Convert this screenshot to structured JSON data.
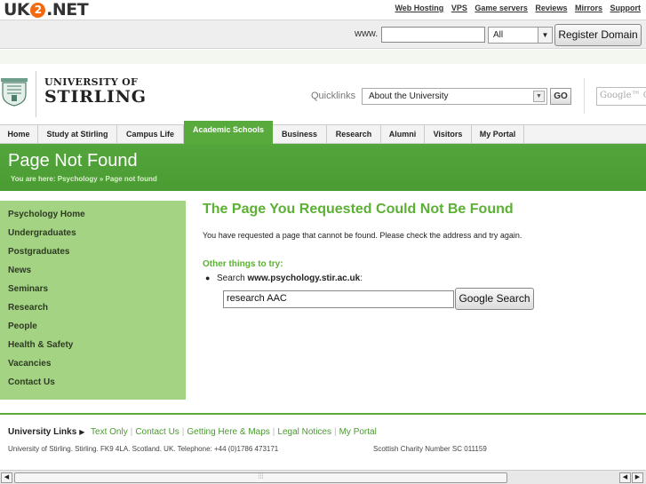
{
  "host": {
    "logo_prefix": "UK",
    "logo_two": "2",
    "logo_suffix": ".NET",
    "links": [
      "Web Hosting",
      "VPS",
      "Game servers",
      "Reviews",
      "Mirrors",
      "Support"
    ]
  },
  "domain_search": {
    "www_label": "www.",
    "input_value": "",
    "tld_selected": "All",
    "register_label": "Register Domain"
  },
  "university": {
    "name_line1": "UNIVERSITY OF",
    "name_line2": "STIRLING",
    "crest_icon": "university-crest-icon",
    "quicklinks_label": "Quicklinks",
    "quicklinks_selected": "About the University",
    "go_label": "GO",
    "google_placeholder": "Google™ Cu"
  },
  "nav": {
    "items": [
      "Home",
      "Study at Stirling",
      "Campus Life",
      "Academic Schools",
      "Business",
      "Research",
      "Alumni",
      "Visitors",
      "My Portal"
    ],
    "active": "Academic Schools"
  },
  "banner": {
    "title": "Page Not Found",
    "breadcrumb": "You are here: Psychology » Page not found"
  },
  "sidebar": {
    "items": [
      "Psychology Home",
      "Undergraduates",
      "Postgraduates",
      "News",
      "Seminars",
      "Research",
      "People",
      "Health & Safety",
      "Vacancies",
      "Contact Us"
    ]
  },
  "main": {
    "title": "The Page You Requested Could Not Be Found",
    "message": "You have requested a page that cannot be found. Please check the address and try again.",
    "other_title": "Other things to try:",
    "search_prefix": "Search ",
    "search_site": "www.psychology.stir.ac.uk",
    "search_suffix": ":",
    "search_value": "research AAC",
    "search_button": "Google Search"
  },
  "footer": {
    "links_label": "University Links",
    "links": [
      "Text Only",
      "Contact Us",
      "Getting Here & Maps",
      "Legal Notices",
      "My Portal"
    ],
    "address": "University of Stirling. Stirling. FK9 4LA. Scotland. UK. Telephone: +44 (0)1786 473171",
    "charity": "Scottish Charity Number SC 011159"
  },
  "colors": {
    "accent_green": "#58aa3c",
    "heading_green": "#5cb033",
    "sidebar_green": "#a4d383",
    "host_orange": "#f26a0f"
  }
}
